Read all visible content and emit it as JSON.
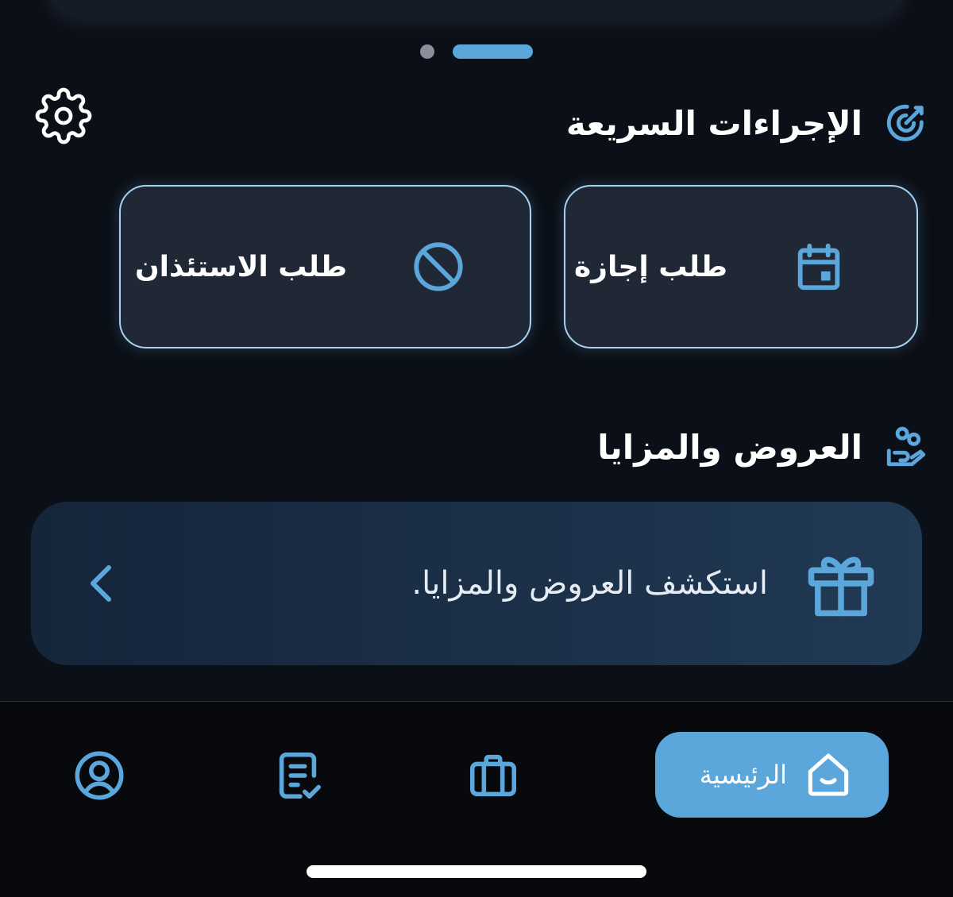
{
  "colors": {
    "background": "#0b0f17",
    "accent": "#5ba7dc",
    "card_border": "#a7d2f4",
    "card_bg": "#202735",
    "text": "#ffffff"
  },
  "pager": {
    "page_count": 2,
    "active_index": 1
  },
  "quick_actions": {
    "title": "الإجراءات السريعة",
    "title_icon": "target-pen-icon",
    "settings_icon": "gear-icon",
    "cards": [
      {
        "label": "طلب إجازة",
        "icon": "calendar-icon"
      },
      {
        "label": "طلب الاستئذان",
        "icon": "prohibited-icon"
      }
    ]
  },
  "offers": {
    "title": "العروض والمزايا",
    "title_icon": "hand-people-icon",
    "banner_text": "استكشف العروض والمزايا.",
    "banner_icon": "gift-icon",
    "banner_arrow": "chevron-left-icon"
  },
  "bottom_nav": {
    "home_label": "الرئيسية",
    "items": [
      {
        "icon": "home-icon",
        "active": true
      },
      {
        "icon": "briefcase-icon",
        "active": false
      },
      {
        "icon": "document-check-icon",
        "active": false
      },
      {
        "icon": "user-circle-icon",
        "active": false
      }
    ]
  }
}
